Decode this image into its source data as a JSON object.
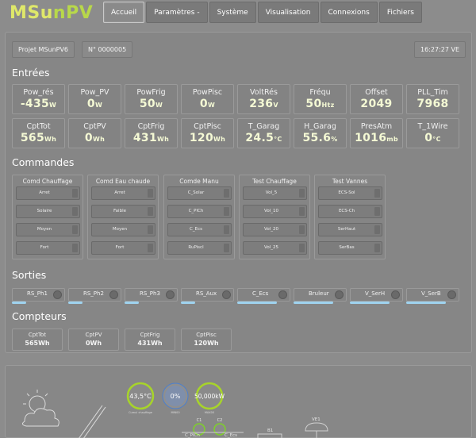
{
  "app": {
    "logo": "MSunPV"
  },
  "nav": {
    "tabs": [
      "Accueil",
      "Paramètres -",
      "Système",
      "Visualisation",
      "Connexions",
      "Fichiers"
    ]
  },
  "header": {
    "project": "Projet MSunPV6",
    "serial": "N° 0000005",
    "time": "16:27:27 VE"
  },
  "sections": {
    "entrees": "Entrées",
    "commandes": "Commandes",
    "sorties": "Sorties",
    "compteurs": "Compteurs"
  },
  "entrees": [
    {
      "label": "Pow_rés",
      "value": "-435",
      "unit": "W"
    },
    {
      "label": "Pow_PV",
      "value": "0",
      "unit": "W"
    },
    {
      "label": "PowFrig",
      "value": "50",
      "unit": "W"
    },
    {
      "label": "PowPisc",
      "value": "0",
      "unit": "W"
    },
    {
      "label": "VoltRés",
      "value": "236",
      "unit": "V"
    },
    {
      "label": "Fréqu",
      "value": "50",
      "unit": "Htz"
    },
    {
      "label": "Offset",
      "value": "2049",
      "unit": ""
    },
    {
      "label": "PLL_Tim",
      "value": "7968",
      "unit": ""
    },
    {
      "label": "CptTot",
      "value": "565",
      "unit": "Wh"
    },
    {
      "label": "CptPV",
      "value": "0",
      "unit": "Wh"
    },
    {
      "label": "CptFrig",
      "value": "431",
      "unit": "Wh"
    },
    {
      "label": "CptPisc",
      "value": "120",
      "unit": "Wh"
    },
    {
      "label": "T_Garag",
      "value": "24.5",
      "unit": "°C"
    },
    {
      "label": "H_Garag",
      "value": "55.6",
      "unit": "%"
    },
    {
      "label": "PresAtm",
      "value": "1016",
      "unit": "mb"
    },
    {
      "label": "T_1Wire",
      "value": "0",
      "unit": "°C"
    }
  ],
  "commandes": [
    {
      "title": "Comd Chauffage",
      "buttons": [
        "Arret",
        "Solaire",
        "Moyen",
        "Fort"
      ]
    },
    {
      "title": "Comd Eau chaude",
      "buttons": [
        "Arret",
        "Faible",
        "Moyen",
        "Fort"
      ]
    },
    {
      "title": "Comde Manu",
      "buttons": [
        "C_Solar",
        "C_PICh",
        "C_Ecs",
        "RuPiscl"
      ]
    },
    {
      "title": "Test Chauffage",
      "buttons": [
        "Vol_5",
        "Vol_10",
        "Vol_20",
        "Vol_25"
      ]
    },
    {
      "title": "Test Vannes",
      "buttons": [
        "ECS-Sol",
        "ECS-Ch",
        "SerHaut",
        "SerBas"
      ]
    }
  ],
  "sorties": [
    "RS_Ph1",
    "RS_Ph2",
    "RS_Ph3",
    "RS_Aux",
    "C_Ecs",
    "Bruleur",
    "V_SerH",
    "V_SerB"
  ],
  "compteurs": [
    {
      "label": "CptTot",
      "value": "565Wh"
    },
    {
      "label": "CptPV",
      "value": "0Wh"
    },
    {
      "label": "CptFrig",
      "value": "431Wh"
    },
    {
      "label": "CptPisc",
      "value": "120Wh"
    }
  ],
  "synoptic": {
    "gauges": [
      {
        "value": "43,5°C",
        "sub": "Cumul chauffage"
      },
      {
        "value": "0%",
        "sub": "MIN00"
      },
      {
        "value": "50,000kW",
        "sub": "MAX00"
      }
    ],
    "labels": [
      "C1",
      "C2",
      "C_PICh",
      "C_Ecs",
      "B1",
      "VE1"
    ]
  },
  "colors": {
    "accent_value": "#f4f9d4",
    "logo": "#dfe86a",
    "output_bar": "#9fd3ef",
    "gauge_green": "#a7d42a",
    "gauge_blue": "#4a7fd0"
  }
}
